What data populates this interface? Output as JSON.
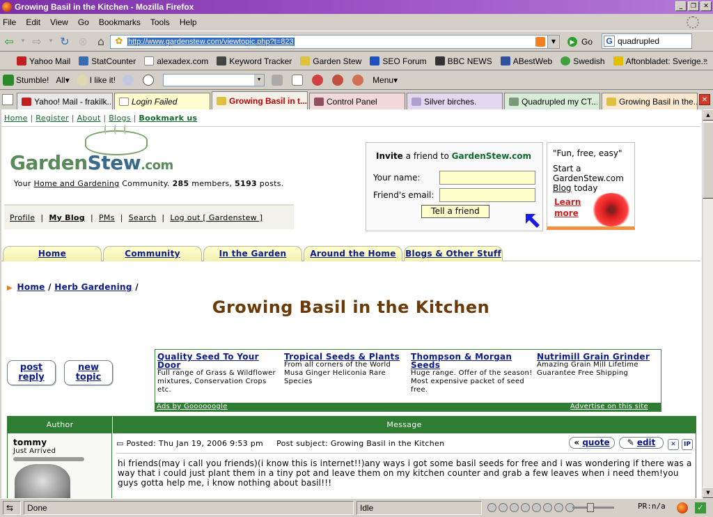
{
  "window": {
    "title": "Growing Basil in the Kitchen - Mozilla Firefox"
  },
  "menu": [
    "File",
    "Edit",
    "View",
    "Go",
    "Bookmarks",
    "Tools",
    "Help"
  ],
  "nav": {
    "url": "http://www.gardenstew.com/viewtopic.php?t=823",
    "go_label": "Go",
    "search_value": "quadrupled"
  },
  "bookmarks": [
    "Yahoo Mail",
    "StatCounter",
    "alexadex.com",
    "Keyword Tracker",
    "Garden Stew",
    "SEO Forum",
    "BBC NEWS",
    "ABestWeb",
    "Swedish",
    "Aftonbladet: Sverige..."
  ],
  "stumble": {
    "stumble_label": "Stumble!",
    "all_label": "All▾",
    "like_label": "I like it!",
    "menu_label": "Menu▾"
  },
  "tabs": [
    "Yahoo! Mail - frakilk...",
    "Login Failed",
    "Growing Basil in t...",
    "Control Panel",
    "Silver birches.",
    "Quadrupled my CT...",
    "Growing Basil in the..."
  ],
  "site": {
    "toplinks": [
      "Home",
      "Register",
      "About",
      "Blogs"
    ],
    "bookmark_us": "Bookmark us",
    "logo_garden": "Garden",
    "logo_stew": "Stew",
    "logo_com": ".com",
    "tagline_pre": "Your",
    "tagline_link": "Home and Gardening",
    "tagline_mid": "Community.",
    "members": "285",
    "members_label": "members,",
    "posts": "5193",
    "posts_label": "posts.",
    "usernav": [
      "Profile",
      "My Blog",
      "PMs",
      "Search",
      "Log out [ Gardenstew ]"
    ]
  },
  "invite": {
    "heading_pre": "Invite",
    "heading_mid": "a friend to",
    "heading_site": "GardenStew.com",
    "name_label": "Your name:",
    "email_label": "Friend's email:",
    "button": "Tell a friend"
  },
  "promo": {
    "quote": "\"Fun, free, easy\"",
    "text1": "Start a GardenStew.com",
    "blog": "Blog",
    "text2": "today",
    "learn1": "Learn",
    "learn2": "more"
  },
  "mainnav": [
    "Home",
    "Community",
    "In the Garden",
    "Around the Home",
    "Blogs & Other Stuff"
  ],
  "breadcrumb": [
    "Home",
    "Herb Gardening"
  ],
  "page_title": "Growing Basil in the Kitchen",
  "buttons": {
    "post_reply_1": "post",
    "post_reply_2": "reply",
    "new_topic_1": "new",
    "new_topic_2": "topic"
  },
  "ads": [
    {
      "title": "Quality Seed To Your Door",
      "text": "Full range of Grass & Wildflower mixtures, Conservation Crops etc."
    },
    {
      "title": "Tropical Seeds & Plants",
      "text": "From all corners of the World Musa Ginger Heliconia Rare Species"
    },
    {
      "title": "Thompson & Morgan Seeds",
      "text": "Huge range. Offer of the season! Most expensive packet of seed free."
    },
    {
      "title": "Nutrimill Grain Grinder",
      "text": "Amazing Grain Mill Lifetime Guarantee Free Shipping"
    }
  ],
  "ads_footer": {
    "left": "Ads by Goooooogle",
    "right": "Advertise on this site"
  },
  "post": {
    "author_header": "Author",
    "message_header": "Message",
    "author": "tommy",
    "rank": "Just Arrived",
    "posted_label": "Posted:",
    "posted": "Thu Jan 19, 2006 9:53 pm",
    "subject_label": "Post subject:",
    "subject": "Growing Basil in the Kitchen",
    "quote_btn": "quote",
    "edit_btn": "edit",
    "body": "hi friends(may i call you friends)(i know this is internet!!)any ways i got some basil seeds for free and i was wondering if there was a way that i could just plant them in a tiny pot and leave them on my kitchen counter and grab a few leaves when i need them!you guys gotta help me, i know nothing about basil!!!"
  },
  "status": {
    "text": "Done",
    "state": "Idle",
    "pr": "PR:n/a"
  }
}
